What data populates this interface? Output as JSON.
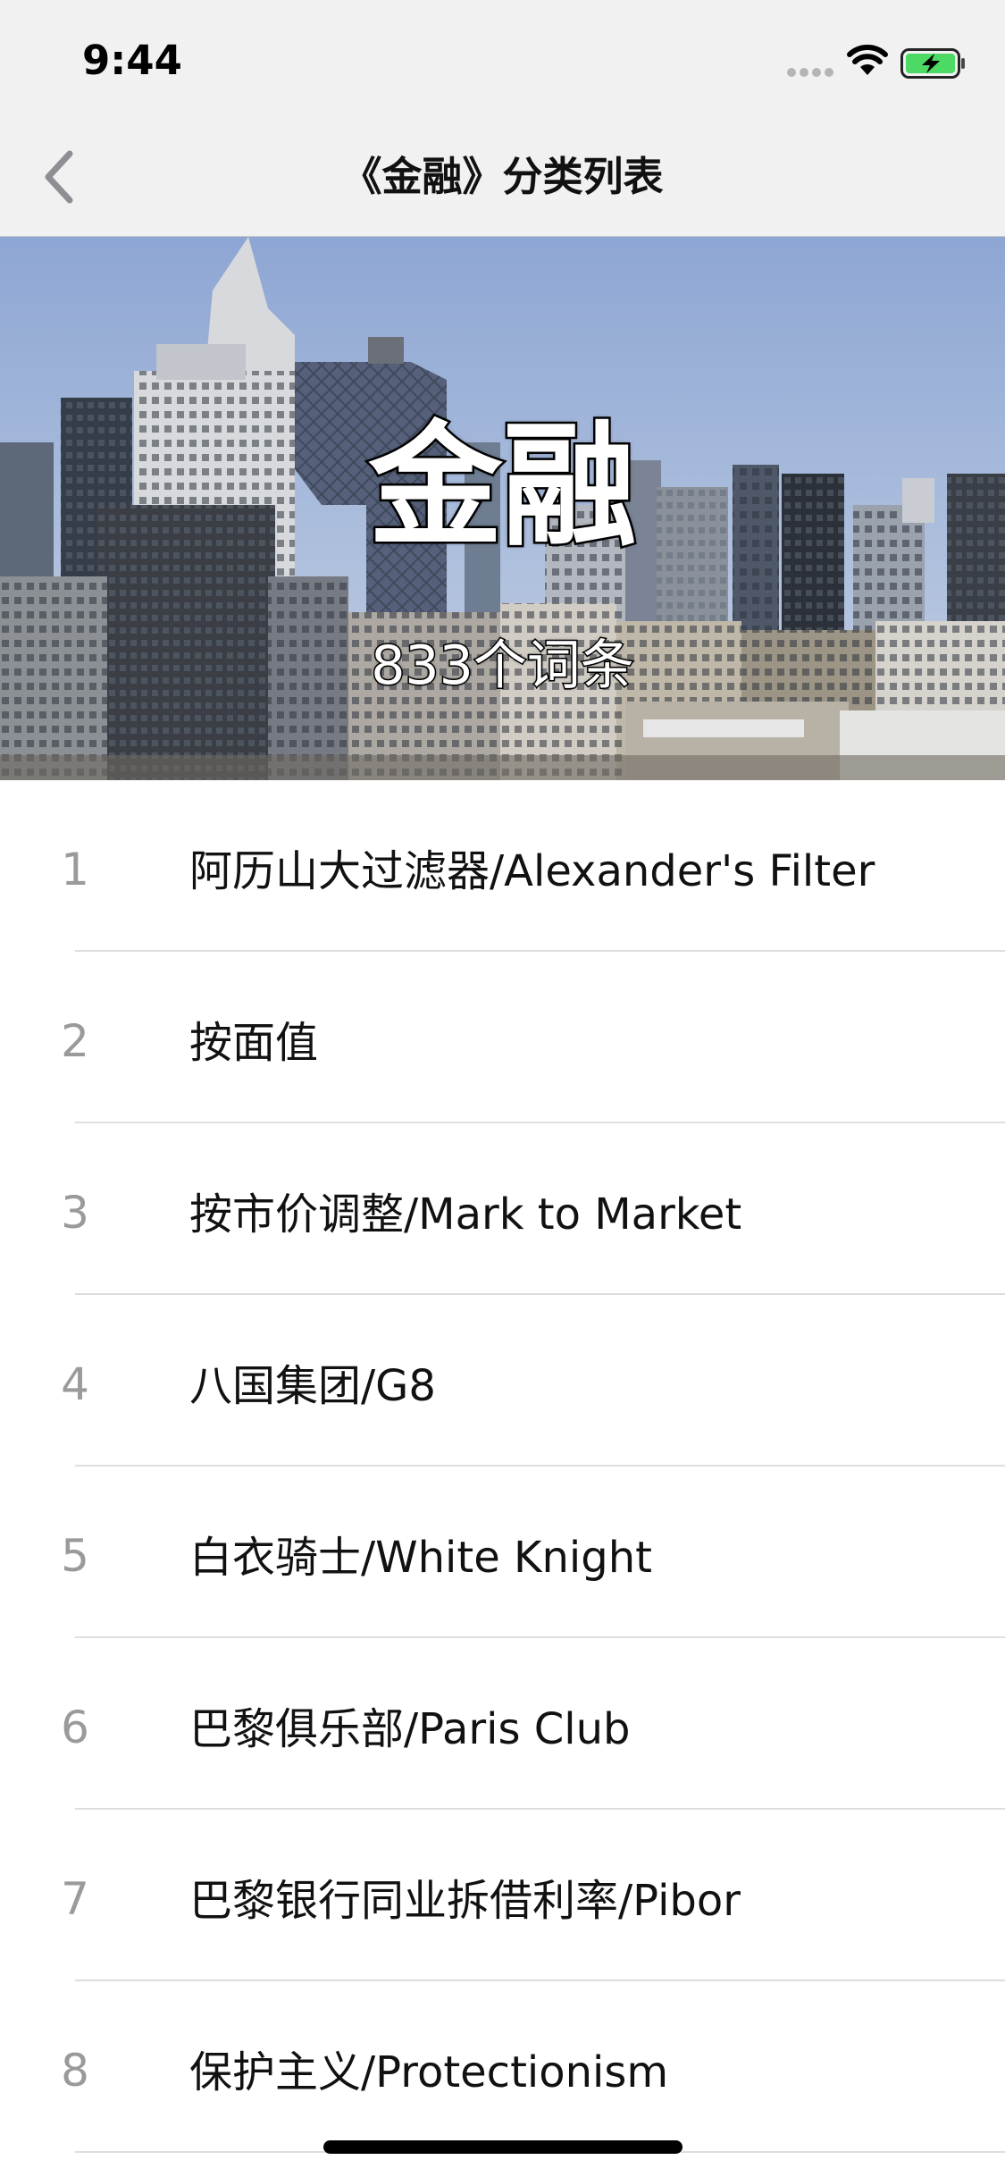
{
  "status_bar": {
    "time": "9:44",
    "signal_icon": "cellular-dots-icon",
    "wifi_icon": "wifi-icon",
    "battery_icon": "battery-charging-icon",
    "battery_color": "#4cd964"
  },
  "nav": {
    "back_icon": "chevron-left-icon",
    "title": "《金融》分类列表"
  },
  "hero": {
    "title": "金融",
    "count_label": "833个词条"
  },
  "terms": [
    {
      "index": "1",
      "label": "阿历山大过滤器/Alexander's Filter"
    },
    {
      "index": "2",
      "label": "按面值"
    },
    {
      "index": "3",
      "label": "按市价调整/Mark to Market"
    },
    {
      "index": "4",
      "label": "八国集团/G8"
    },
    {
      "index": "5",
      "label": "白衣骑士/White Knight"
    },
    {
      "index": "6",
      "label": "巴黎俱乐部/Paris Club"
    },
    {
      "index": "7",
      "label": "巴黎银行同业拆借利率/Pibor"
    },
    {
      "index": "8",
      "label": "保护主义/Protectionism"
    }
  ],
  "colors": {
    "bar_background": "#f1f1f1",
    "index_text": "#9a9a9a",
    "separator": "#dedede",
    "back_chevron": "#8e8e93"
  }
}
